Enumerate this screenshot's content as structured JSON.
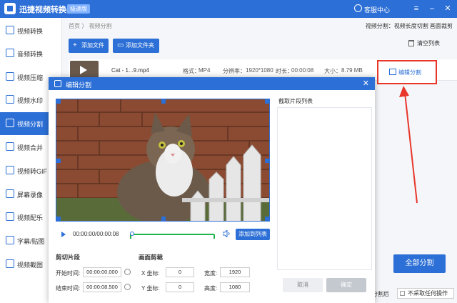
{
  "app": {
    "title": "迅捷视频转换器",
    "badge": "极速版",
    "service": "客服中心"
  },
  "sidebar": {
    "items": [
      {
        "label": "视频转换"
      },
      {
        "label": "音频转换"
      },
      {
        "label": "视频压缩"
      },
      {
        "label": "视频水印"
      },
      {
        "label": "视频分割"
      },
      {
        "label": "视频合并"
      },
      {
        "label": "视频转GIF"
      },
      {
        "label": "屏幕录像"
      },
      {
        "label": "视频配乐"
      },
      {
        "label": "字幕/贴图"
      },
      {
        "label": "视频截图"
      }
    ],
    "active_index": 4
  },
  "main": {
    "breadcrumb": "首页 〉 视频分割",
    "mode_info": "视频分割：视频长度切割 画面裁剪",
    "add_file": "添加文件",
    "add_folder": "添加文件夹",
    "clear_list": "清空列表",
    "file": {
      "name": "Cat - 1...9.mp4",
      "format_label": "格式：",
      "format": "MP4",
      "resolution_label": "分辨率：",
      "resolution": "1920*1080",
      "duration_label": "时长：",
      "duration": "00:00:08",
      "size_label": "大小：",
      "size": "8.79 MB"
    },
    "edit_split": "编辑分割",
    "full_split": "全部分割",
    "after_label": "分割后",
    "after_option": "不采取任何操作"
  },
  "dialog": {
    "title": "编辑分割",
    "time_display": "00:00:00/00:00:08",
    "add_to_list": "添加到列表",
    "clips_title": "截取片段列表",
    "cut_section": "剪切片段",
    "start_label": "开始时间:",
    "start_value": "00:00:00.000",
    "end_label": "结束时间:",
    "end_value": "00:00:08.500",
    "crop_section": "画面剪裁",
    "x_label": "X 坐标:",
    "x_value": "0",
    "y_label": "Y 坐标:",
    "y_value": "0",
    "width_label": "宽度:",
    "width_value": "1920",
    "height_label": "高度:",
    "height_value": "1080",
    "cancel": "取消",
    "ok": "确定"
  },
  "colors": {
    "accent": "#2c6fd6",
    "highlight": "#e8362b",
    "track": "#22b34e"
  }
}
